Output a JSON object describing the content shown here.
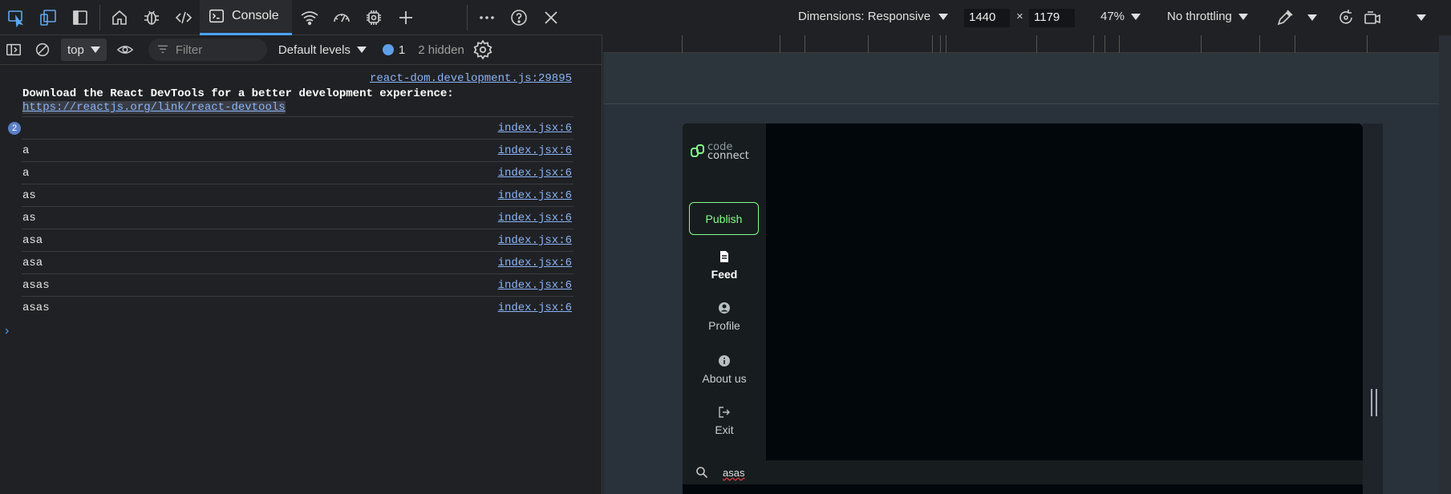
{
  "toolbar": {
    "tabs": [
      {
        "icon": "inspect-icon"
      },
      {
        "icon": "device-toolbar-icon"
      },
      {
        "icon": "sidebar-toggle-icon"
      },
      {
        "icon": "welcome-home-icon"
      },
      {
        "icon": "bug-icon"
      },
      {
        "icon": "elements-code-icon"
      },
      {
        "icon": "console-icon",
        "label": "Console"
      },
      {
        "icon": "network-wifi-icon"
      },
      {
        "icon": "performance-gauge-icon"
      },
      {
        "icon": "memory-chip-icon"
      },
      {
        "icon": "add-tab-icon"
      }
    ],
    "right_icons": [
      "more-icon",
      "help-icon",
      "close-icon"
    ],
    "console_label": "Console"
  },
  "filterbar": {
    "context": "top",
    "filter_placeholder": "Filter",
    "levels": "Default levels",
    "message_count": "1",
    "hidden": "2 hidden"
  },
  "console": {
    "react_source": "react-dom.development.js:29895",
    "react_message": "Download the React DevTools for a better development experience:",
    "react_link": "https://reactjs.org/link/react-devtools",
    "rows": [
      {
        "badge": "2",
        "text": "",
        "source": "index.jsx:6"
      },
      {
        "text": "a",
        "source": "index.jsx:6"
      },
      {
        "text": "a",
        "source": "index.jsx:6"
      },
      {
        "text": "as",
        "source": "index.jsx:6"
      },
      {
        "text": "as",
        "source": "index.jsx:6"
      },
      {
        "text": "asa",
        "source": "index.jsx:6"
      },
      {
        "text": "asa",
        "source": "index.jsx:6"
      },
      {
        "text": "asas",
        "source": "index.jsx:6"
      },
      {
        "text": "asas",
        "source": "index.jsx:6"
      }
    ],
    "prompt": "›"
  },
  "emulation": {
    "dimensions_label": "Dimensions: Responsive",
    "width": "1440",
    "height": "1179",
    "times": "×",
    "zoom": "47%",
    "throttling": "No throttling"
  },
  "app": {
    "logo_line1": "code",
    "logo_line2": "connect",
    "publish": "Publish",
    "nav": [
      {
        "label": "Feed",
        "icon": "document-icon",
        "active": true
      },
      {
        "label": "Profile",
        "icon": "user-circle-icon"
      },
      {
        "label": "About us",
        "icon": "info-icon"
      },
      {
        "label": "Exit",
        "icon": "exit-icon"
      }
    ],
    "search_value": "asas",
    "accent": "#81FE88"
  }
}
